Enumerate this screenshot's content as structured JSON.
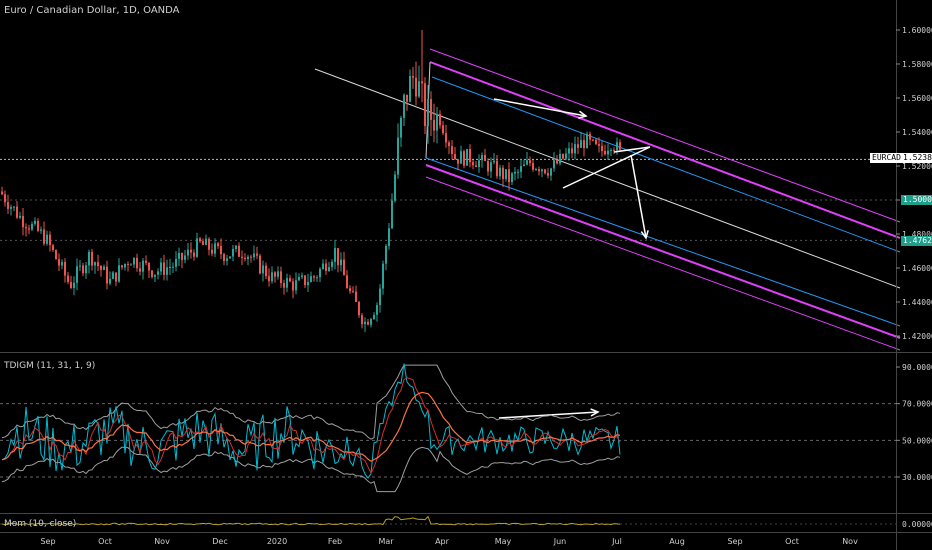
{
  "header": {
    "title": "Euro / Canadian Dollar, 1D, OANDA"
  },
  "indicators": {
    "tdigm_label": "TDIGM (11, 31, 1, 9)",
    "mom_label": "Mom (10, close)"
  },
  "price_tag": {
    "symbol": "EURCAD",
    "value": "1.52389",
    "color": "#ffffff"
  },
  "level_tags": [
    {
      "value": "1.50000",
      "color": "#1f9e8a"
    },
    {
      "value": "1.47623",
      "color": "#1f9e8a"
    }
  ],
  "colors": {
    "background": "#000000",
    "up_candle": "#26a69a",
    "down_candle": "#ef5350",
    "channel_magenta": "#e040fb",
    "channel_blue": "#2196f3",
    "arrow": "#ffffff",
    "tdi_green": "#00bcd4",
    "tdi_red": "#e53935",
    "mom_line": "#b8a030"
  },
  "chart_data": [
    {
      "type": "line",
      "title": "Euro / Canadian Dollar, 1D, OANDA",
      "y_ticks": [
        "1.60000",
        "1.58000",
        "1.56000",
        "1.54000",
        "1.52000",
        "1.50000",
        "1.48000",
        "1.46000",
        "1.44000",
        "1.42000"
      ],
      "x_ticks": [
        "Sep",
        "Oct",
        "Nov",
        "Dec",
        "2020",
        "Feb",
        "Mar",
        "Apr",
        "May",
        "Jun",
        "Jul",
        "Aug",
        "Sep",
        "Oct",
        "Nov"
      ],
      "ylim": [
        1.41,
        1.61
      ],
      "last_price": 1.52389
    },
    {
      "type": "line",
      "title": "TDIGM (11, 31, 1, 9)",
      "y_ticks": [
        "90.00000",
        "70.00000",
        "50.00000",
        "30.00000"
      ],
      "ylim": [
        20,
        92
      ]
    },
    {
      "type": "line",
      "title": "Mom (10, close)",
      "y_ticks": [
        "0.00000"
      ]
    }
  ]
}
